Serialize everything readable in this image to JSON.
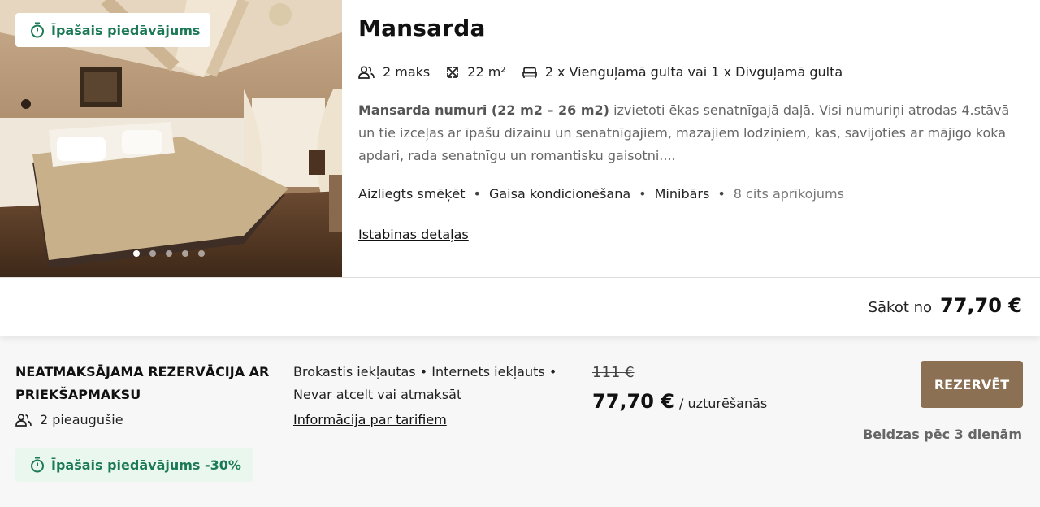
{
  "room": {
    "image_badge": "Īpašais piedāvājums",
    "title": "Mansarda",
    "capacity": "2 maks",
    "area": "22 m²",
    "beds": "2 x Vienguļamā gulta vai 1 x Divguļamā gulta",
    "description_bold": "Mansarda numuri (22 m2 – 26 m2)",
    "description_rest": " izvietoti ēkas senatnīgajā daļā. Visi numuriņi atrodas 4.stāvā un tie izceļas ar īpašu dizainu un senatnīgajiem, mazajiem lodziņiem, kas, savijoties ar mājīgo koka apdari, rada senatnīgu un romantisku gaisotni....",
    "amenities": [
      "Aizliegts smēķēt",
      "Gaisa kondicionēšana",
      "Minibārs"
    ],
    "more_amenities": "8 cits aprīkojums",
    "details_link": "Istabinas detaļas",
    "image_count": 5,
    "active_image": 1
  },
  "price_from": {
    "label": "Sākot no",
    "value": "77,70 €"
  },
  "rate": {
    "name": "NEATMAKSĀJAMA REZERVĀCIJA AR PRIEKŠAPMAKSU",
    "guests": "2 pieaugušie",
    "offer_badge": "Īpašais piedāvājums -30%",
    "inclusions": "Brokastis iekļautas • Internets iekļauts • Nevar atcelt vai atmaksāt",
    "tariff_link": "Informācija par tarifiem",
    "old_price": "111 €",
    "new_price": "77,70 €",
    "price_unit": "/ uzturēšanās",
    "reserve_label": "REZERVĒT",
    "expires": "Beidzas pēc 3 dienām"
  },
  "colors": {
    "accent_button": "#8c7054",
    "offer_green": "#1b7a55",
    "offer_bg": "#e9f7ef"
  }
}
